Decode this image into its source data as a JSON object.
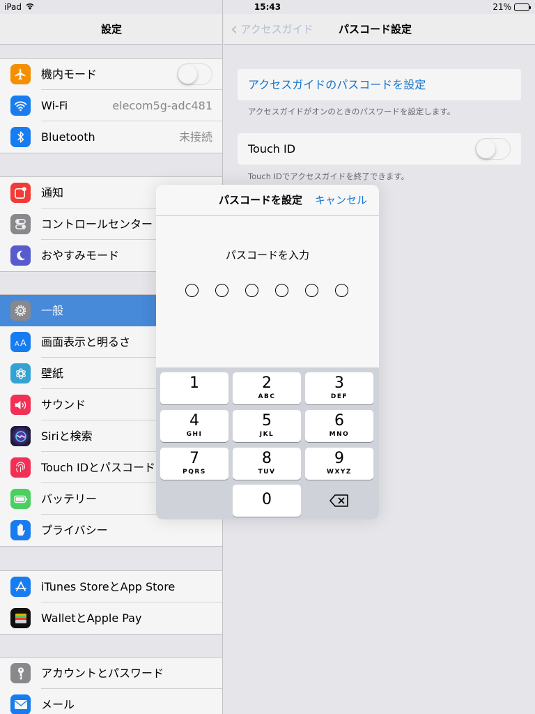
{
  "status_bar": {
    "device": "iPad",
    "time": "15:43",
    "battery": "21%",
    "battery_level": 0.21
  },
  "left": {
    "header_title": "設定",
    "groups": [
      {
        "items": [
          {
            "label": "機内モード",
            "icon": "airplane-icon",
            "color": "#ff9500",
            "control": "switch",
            "switch_on": false
          },
          {
            "label": "Wi-Fi",
            "icon": "wifi-icon",
            "color": "#1a82fb",
            "value": "elecom5g-adc481"
          },
          {
            "label": "Bluetooth",
            "icon": "bluetooth-icon",
            "color": "#1a82fb",
            "value": "未接続"
          }
        ]
      },
      {
        "items": [
          {
            "label": "通知",
            "icon": "notifications-icon",
            "color": "#fc3d39"
          },
          {
            "label": "コントロールセンター",
            "icon": "control-center-icon",
            "color": "#8e8e93"
          },
          {
            "label": "おやすみモード",
            "icon": "moon-icon",
            "color": "#5b5fd6"
          }
        ]
      },
      {
        "items": [
          {
            "label": "一般",
            "icon": "gear-icon",
            "color": "#8e8e93",
            "selected": true
          },
          {
            "label": "画面表示と明るさ",
            "icon": "display-icon",
            "color": "#1a82fb"
          },
          {
            "label": "壁紙",
            "icon": "wallpaper-icon",
            "color": "#35aadc"
          },
          {
            "label": "サウンド",
            "icon": "speaker-icon",
            "color": "#fc3158"
          },
          {
            "label": "Siriと検索",
            "icon": "siri-icon",
            "color": "#222"
          },
          {
            "label": "Touch IDとパスコード",
            "icon": "fingerprint-icon",
            "color": "#fc3158"
          },
          {
            "label": "バッテリー",
            "icon": "battery-icon",
            "color": "#4cd964"
          },
          {
            "label": "プライバシー",
            "icon": "hand-icon",
            "color": "#1a82fb"
          }
        ]
      },
      {
        "items": [
          {
            "label": "iTunes StoreとApp Store",
            "icon": "app-store-icon",
            "color": "#1a82fb"
          },
          {
            "label": "WalletとApple Pay",
            "icon": "wallet-icon",
            "color": "#111"
          }
        ]
      },
      {
        "items": [
          {
            "label": "アカウントとパスワード",
            "icon": "key-icon",
            "color": "#8e8e93"
          },
          {
            "label": "メール",
            "icon": "mail-icon",
            "color": "#1a82fb"
          }
        ]
      }
    ]
  },
  "right": {
    "back_label": "アクセスガイド",
    "title": "パスコード設定",
    "set_passcode_label": "アクセスガイドのパスコードを設定",
    "set_passcode_footer": "アクセスガイドがオンのときのパスワードを設定します。",
    "touch_id_label": "Touch ID",
    "touch_id_footer": "Touch IDでアクセスガイドを終了できます。",
    "touch_id_on": false
  },
  "modal": {
    "title": "パスコードを設定",
    "cancel_label": "キャンセル",
    "prompt": "パスコードを入力",
    "passcode_length": 6,
    "keys": [
      {
        "digit": "1",
        "letters": ""
      },
      {
        "digit": "2",
        "letters": "ABC"
      },
      {
        "digit": "3",
        "letters": "DEF"
      },
      {
        "digit": "4",
        "letters": "GHI"
      },
      {
        "digit": "5",
        "letters": "JKL"
      },
      {
        "digit": "6",
        "letters": "MNO"
      },
      {
        "digit": "7",
        "letters": "PQRS"
      },
      {
        "digit": "8",
        "letters": "TUV"
      },
      {
        "digit": "9",
        "letters": "WXYZ"
      },
      {
        "digit": "0",
        "letters": ""
      }
    ]
  }
}
